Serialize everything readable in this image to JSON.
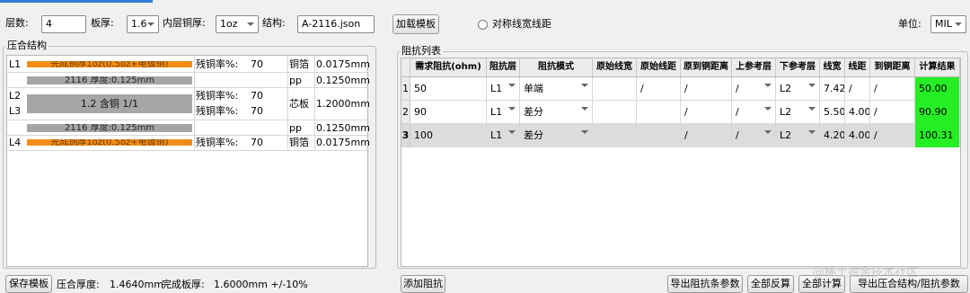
{
  "toolbar": {
    "layers_label": "层数:",
    "layers_value": "4",
    "thickness_label": "板厚:",
    "thickness_value": "1.6",
    "inner_copper_label": "内层铜厚:",
    "inner_copper_value": "1oz",
    "structure_label": "结构:",
    "structure_value": "A-2116.json",
    "load_template_label": "加载模板",
    "symmetric_label": "对称线宽线距",
    "unit_label": "单位:",
    "unit_value": "MIL"
  },
  "stackup": {
    "title": "压合结构",
    "rows": [
      {
        "layer": "L1",
        "bar": "完成铜厚1oz(0.5oz+电镀铜)",
        "kind": "copper",
        "rate_label": "残铜率%:",
        "rate": "70",
        "material": "铜箔",
        "thickness": "0.0175mm"
      },
      {
        "layer": "",
        "bar": "2116 厚度:0.125mm",
        "kind": "pp",
        "rate_label": "",
        "rate": "",
        "material": "pp",
        "thickness": "0.1250mm"
      },
      {
        "layer": "L2",
        "layer2": "L3",
        "bar": "1.2 含铜 1/1",
        "kind": "core",
        "rate_label": "残铜率%:",
        "rate": "70",
        "rate_label2": "残铜率%:",
        "rate2": "70",
        "material": "芯板",
        "thickness": "1.2000mm"
      },
      {
        "layer": "",
        "bar": "2116 厚度:0.125mm",
        "kind": "pp",
        "rate_label": "",
        "rate": "",
        "material": "pp",
        "thickness": "0.1250mm"
      },
      {
        "layer": "L4",
        "bar": "完成铜厚1oz(0.5oz+电镀铜)",
        "kind": "copper",
        "rate_label": "残铜率%:",
        "rate": "70",
        "material": "铜箔",
        "thickness": "0.0175mm"
      }
    ],
    "save_template_label": "保存模板",
    "press_thickness_label": "压合厚度:",
    "press_thickness_value": "1.4640mm",
    "finish_thickness_label": "完成板厚:",
    "finish_thickness_value": "1.6000mm +/-10%"
  },
  "impedance": {
    "title": "阻抗列表",
    "columns": [
      "需求阻抗(ohm)",
      "阻抗层",
      "阻抗模式",
      "原始线宽",
      "原始线距",
      "原到铜距离",
      "上参考层",
      "下参考层",
      "线宽",
      "线距",
      "到铜距离",
      "计算结果"
    ],
    "rows": [
      {
        "num": "1",
        "target": "50",
        "layer": "L1",
        "mode": "单端",
        "orig_w": "",
        "orig_s": "/",
        "orig_cu": "/",
        "ref_up": "/",
        "ref_down": "L2",
        "width": "7.42",
        "space": "/",
        "to_cu": "/",
        "result": "50.00"
      },
      {
        "num": "2",
        "target": "90",
        "layer": "L1",
        "mode": "差分",
        "orig_w": "",
        "orig_s": "",
        "orig_cu": "/",
        "ref_up": "/",
        "ref_down": "L2",
        "width": "5.50",
        "space": "4.00",
        "to_cu": "/",
        "result": "90.90"
      },
      {
        "num": "3",
        "target": "100",
        "layer": "L1",
        "mode": "差分",
        "orig_w": "",
        "orig_s": "",
        "orig_cu": "/",
        "ref_up": "/",
        "ref_down": "L2",
        "width": "4.20",
        "space": "4.00",
        "to_cu": "/",
        "result": "100.31"
      }
    ],
    "add_label": "添加阻抗",
    "export_params_label": "导出阻抗条参数",
    "reverse_all_label": "全部反算",
    "calc_all_label": "全部计算",
    "export_all_label": "导出压合结构/阻抗参数"
  },
  "watermark": "@稀土掘金技术社区",
  "colors": {
    "copper": "#f28c16",
    "dielectric": "#a6a6a6",
    "result_ok": "#25ee25"
  }
}
